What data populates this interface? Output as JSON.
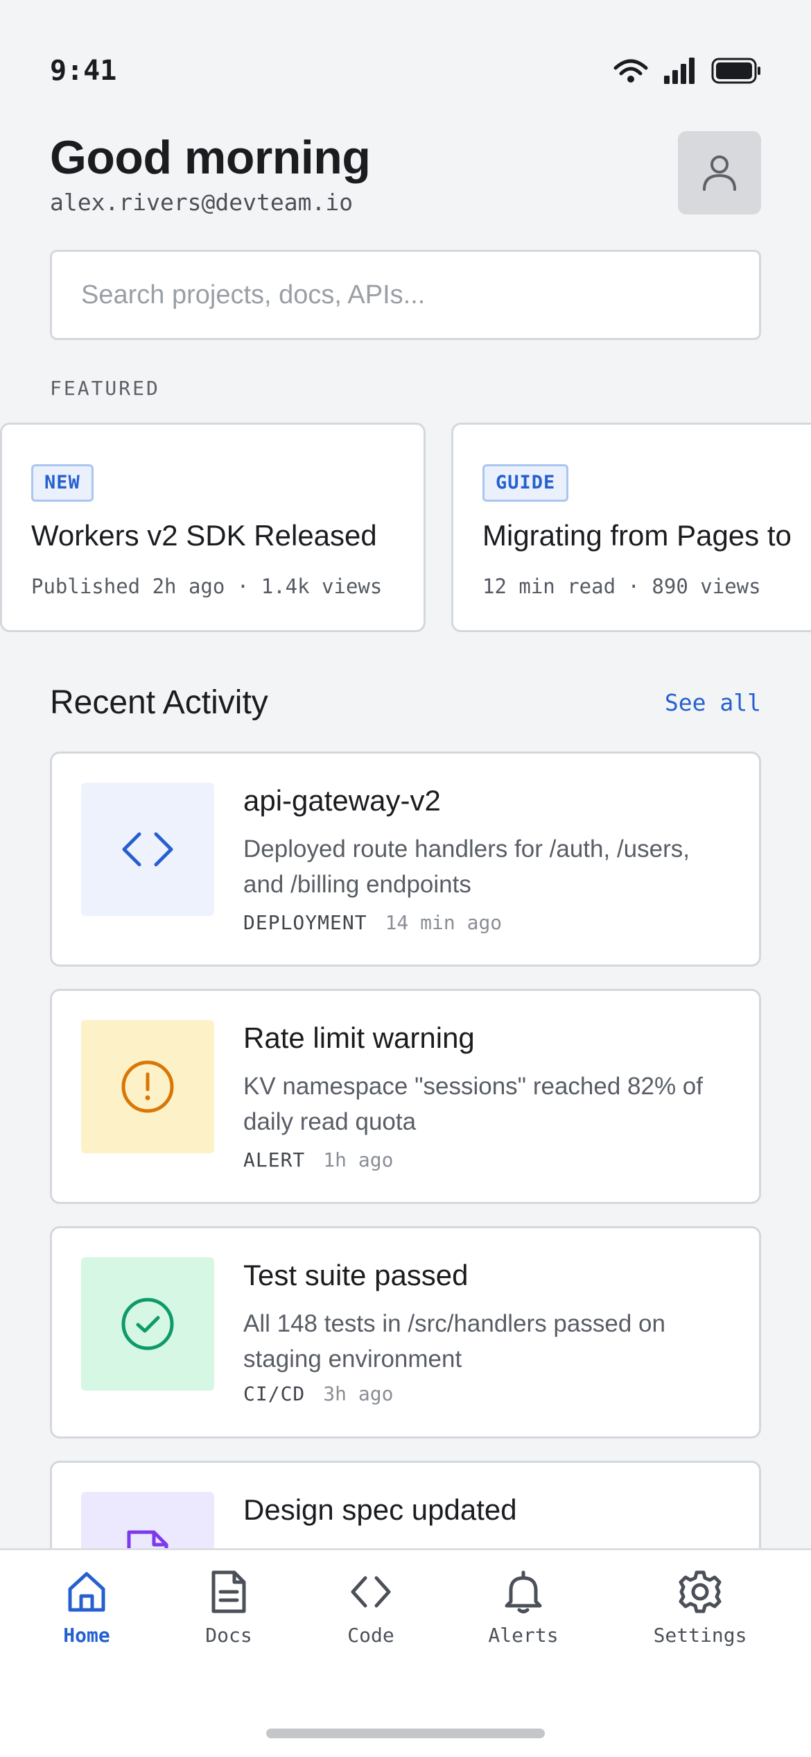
{
  "status": {
    "time": "9:41"
  },
  "header": {
    "greeting": "Good morning",
    "email": "alex.rivers@devteam.io"
  },
  "search": {
    "placeholder": "Search projects, docs, APIs..."
  },
  "featured": {
    "label": "FEATURED",
    "cards": [
      {
        "badge": "NEW",
        "title": "Workers v2 SDK Released",
        "meta": "Published 2h ago · 1.4k views"
      },
      {
        "badge": "GUIDE",
        "title": "Migrating from Pages to",
        "meta": "12 min read · 890 views"
      }
    ]
  },
  "recent": {
    "title": "Recent Activity",
    "see_all": "See all",
    "items": [
      {
        "title": "api-gateway-v2",
        "description": "Deployed route handlers for /auth, /users, and /billing endpoints",
        "type": "DEPLOYMENT",
        "time": "14 min ago",
        "icon": "code-icon",
        "icon_bg": "#eef2fc",
        "icon_color": "#2560d0"
      },
      {
        "title": "Rate limit warning",
        "description": "KV namespace \"sessions\" reached 82% of daily read quota",
        "type": "ALERT",
        "time": "1h ago",
        "icon": "alert-circle-icon",
        "icon_bg": "#fdf1c7",
        "icon_color": "#d97706"
      },
      {
        "title": "Test suite passed",
        "description": "All 148 tests in /src/handlers passed on staging environment",
        "type": "CI/CD",
        "time": "3h ago",
        "icon": "check-circle-icon",
        "icon_bg": "#d5f7e4",
        "icon_color": "#0e9a6a"
      },
      {
        "title": "Design spec updated",
        "icon": "document-icon",
        "icon_bg": "#ece8fd",
        "icon_color": "#7c3aed"
      }
    ]
  },
  "nav": {
    "active": "home",
    "accent": "#2560d0",
    "items": [
      {
        "label": "Home",
        "icon": "home-icon"
      },
      {
        "label": "Docs",
        "icon": "docs-icon"
      },
      {
        "label": "Code",
        "icon": "code-icon"
      },
      {
        "label": "Alerts",
        "icon": "bell-icon"
      },
      {
        "label": "Settings",
        "icon": "gear-icon"
      }
    ]
  }
}
